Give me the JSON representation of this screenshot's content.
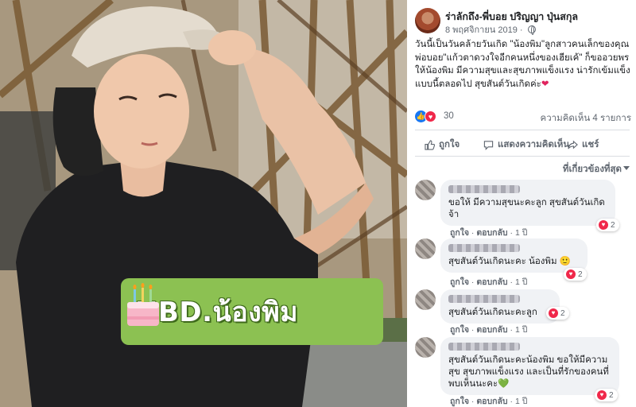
{
  "photo": {
    "overlay_text": "HBD.น้องพิม",
    "overlay_color": "#8cc152",
    "cake_icon": "birthday-cake-icon"
  },
  "post": {
    "author": "ร่าลักถึง-พี่บอย ปริญญา ปุ่นสกุล",
    "date": "8 พฤศจิกายน 2019 · ",
    "privacy_icon": "globe-icon",
    "text": "วันนี้เป็นวันคล้ายวันเกิด \"น้องพิม\"ลูกสาวคนเล็กของคุณพ่อบอย\"แก้วตาดวงใจอีกคนหนึ่งของเฮียเค้\" ก็ขออวยพรให้น้องพิม มีความสุขและสุขภาพแข็งแรง น่ารักเข้มแข็ง แบบนี้ตลอดไป สุขสันต์วันเกิดค่ะ",
    "text_end_icon": "❤"
  },
  "reactions": {
    "count": "30",
    "comments_count": "ความคิดเห็น 4 รายการ",
    "icons": [
      "like-icon",
      "love-icon"
    ]
  },
  "actions": {
    "like": "ถูกใจ",
    "comment": "แสดงความคิดเห็น",
    "share": "แชร์"
  },
  "sort": {
    "label": "ที่เกี่ยวข้องที่สุด"
  },
  "comments": [
    {
      "text": "ขอให้ มีความสุขนะคะลูก สุขสันต์วันเกิดจ้า",
      "like": "ถูกใจ",
      "reply": "ตอบกลับ",
      "time": "1 ปี",
      "reaction_count": "2"
    },
    {
      "text": "สุขสันต์วันเกิดนะคะ น้องพิม 🙂",
      "like": "ถูกใจ",
      "reply": "ตอบกลับ",
      "time": "1 ปี",
      "reaction_count": "2"
    },
    {
      "text": "สุขสันต์วันเกิดนะคะลูก",
      "like": "ถูกใจ",
      "reply": "ตอบกลับ",
      "time": "1 ปี",
      "reaction_count": "2"
    },
    {
      "text": "สุขสันต์วันเกิดนะคะน้องพิม ขอให้มีความสุข สุขภาพแข็งแรง และเป็นที่รักของคนที่พบเห็นนะคะ💚",
      "like": "ถูกใจ",
      "reply": "ตอบกลับ",
      "time": "1 ปี",
      "reaction_count": "2"
    }
  ]
}
